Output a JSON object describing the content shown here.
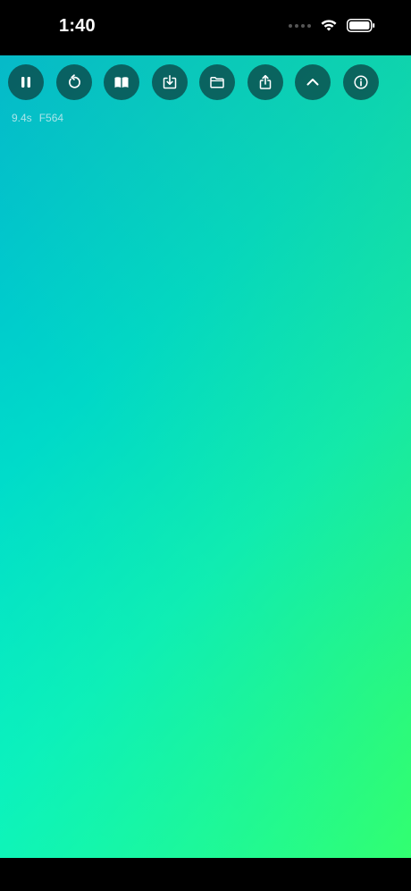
{
  "status_bar": {
    "time": "1:40"
  },
  "toolbar": {
    "buttons": [
      {
        "name": "pause",
        "icon": "pause-icon"
      },
      {
        "name": "restart",
        "icon": "rotate-ccw-icon"
      },
      {
        "name": "library",
        "icon": "book-open-icon"
      },
      {
        "name": "import",
        "icon": "tray-download-icon"
      },
      {
        "name": "folder",
        "icon": "folder-icon"
      },
      {
        "name": "share",
        "icon": "share-icon"
      },
      {
        "name": "collapse",
        "icon": "chevron-up-icon"
      },
      {
        "name": "info",
        "icon": "info-icon"
      }
    ]
  },
  "stats": {
    "time_elapsed": "9.4s",
    "frame": "F564"
  },
  "colors": {
    "gradient_top_left": "#00b8d4",
    "gradient_bottom_left": "#00f5d0",
    "gradient_bottom_right": "#36ff66",
    "button_bg": "#0a4646"
  }
}
